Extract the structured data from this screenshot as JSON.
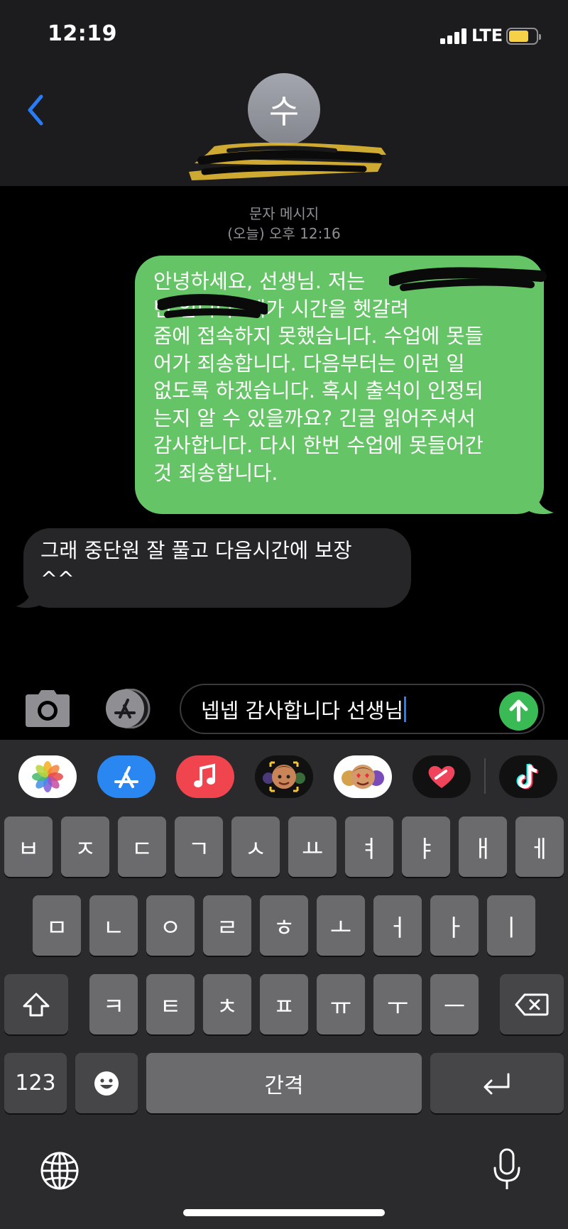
{
  "status_bar": {
    "time": "12:19",
    "network": "LTE",
    "battery_color": "#f6d046"
  },
  "header": {
    "back_icon": "chevron-left-icon",
    "avatar_initial": "수",
    "contact_name_redacted": true
  },
  "thread": {
    "service_label": "문자 메시지",
    "timestamp": "(오늘) 오후 12:16",
    "messages": [
      {
        "direction": "outgoing",
        "text": "안녕하세요, 선생님. 저는 ████████ 번 █████ 입니다. 제가 시간을 헷갈려 줌에 접속하지 못했습니다. 수업에 못들어가 죄송합니다. 다음부터는 이런 일 없도록 하겠습니다. 혹시 출석이 인정되는지 알 수 있을까요? 긴글 읽어주셔서 감사합니다. 다시 한번 수업에 못들어간 것 죄송합니다.",
        "lines": [
          "안녕하세요, 선생님. 저는",
          "번            입니다. 제가 시간을 헷갈려",
          "줌에 접속하지 못했습니다. 수업에 못들",
          "어가 죄송합니다. 다음부터는 이런 일",
          "없도록 하겠습니다. 혹시 출석이 인정되",
          "는지 알 수 있을까요? 긴글 읽어주셔서",
          "감사합니다. 다시 한번 수업에 못들어간",
          "것 죄송합니다."
        ],
        "color": "#65c466"
      },
      {
        "direction": "incoming",
        "lines": [
          "그래 중단원 잘 풀고 다음시간에 보장",
          "^^"
        ],
        "color": "#262628"
      }
    ]
  },
  "compose": {
    "camera_icon": "camera-icon",
    "apps_icon": "app-store-icon",
    "draft_text": "넵넵 감사합니다 선생님",
    "send_icon": "arrow-up-icon",
    "send_color": "#3aba55"
  },
  "app_strip": [
    {
      "name": "photos-app-icon"
    },
    {
      "name": "app-store-app-icon"
    },
    {
      "name": "music-app-icon"
    },
    {
      "name": "memoji-camera-app-icon"
    },
    {
      "name": "memoji-stickers-app-icon"
    },
    {
      "name": "digital-touch-app-icon"
    },
    {
      "name": "tiktok-app-icon"
    }
  ],
  "keyboard": {
    "row1": [
      "ㅂ",
      "ㅈ",
      "ㄷ",
      "ㄱ",
      "ㅅ",
      "ㅛ",
      "ㅕ",
      "ㅑ",
      "ㅐ",
      "ㅔ"
    ],
    "row2": [
      "ㅁ",
      "ㄴ",
      "ㅇ",
      "ㄹ",
      "ㅎ",
      "ㅗ",
      "ㅓ",
      "ㅏ",
      "ㅣ"
    ],
    "row3": [
      "ㅋ",
      "ㅌ",
      "ㅊ",
      "ㅍ",
      "ㅠ",
      "ㅜ",
      "ㅡ"
    ],
    "numbers_label": "123",
    "space_label": "간격",
    "shift_icon": "shift-icon",
    "delete_icon": "backspace-icon",
    "emoji_icon": "emoji-icon",
    "return_icon": "return-icon",
    "globe_icon": "globe-icon",
    "mic_icon": "microphone-icon"
  }
}
